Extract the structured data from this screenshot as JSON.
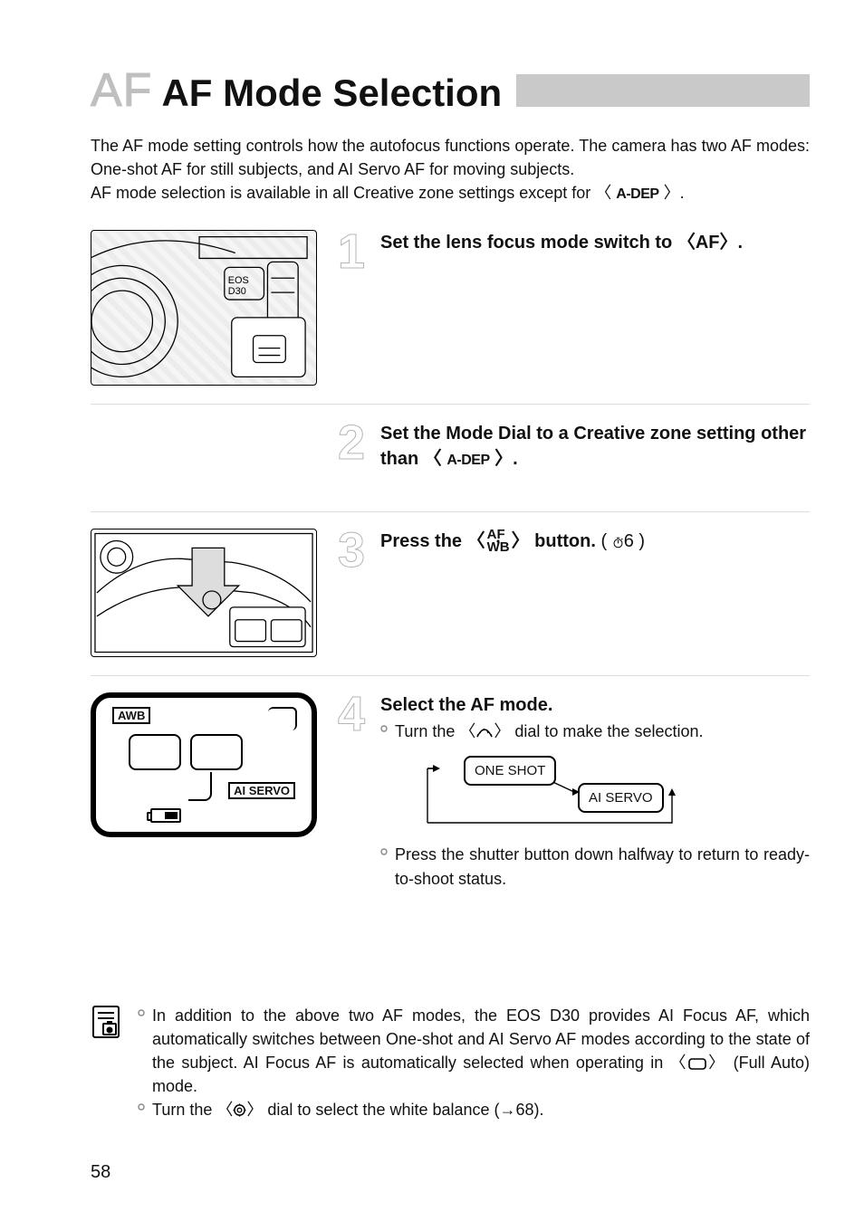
{
  "title": {
    "prefix": "AF",
    "main": "AF Mode Selection"
  },
  "intro": {
    "line1": "The AF mode setting controls how the autofocus functions operate. The camera has two AF modes: One-shot AF for still subjects, and AI Servo AF for moving subjects.",
    "line2_pre": "AF mode selection is available in all Creative zone settings except for 〈 ",
    "adep": "A-DEP",
    "line2_post": " 〉."
  },
  "steps": {
    "s1": {
      "num": "1",
      "heading_pre": "Set the lens focus mode switch to 〈",
      "heading_bold": "AF",
      "heading_post": "〉."
    },
    "s2": {
      "num": "2",
      "heading_pre": "Set the Mode Dial to a Creative zone setting other than 〈 ",
      "adep": "A-DEP",
      "heading_post": " 〉."
    },
    "s3": {
      "num": "3",
      "heading_pre": "Press the 〈",
      "af_top": "AF",
      "af_bot": "WB",
      "heading_mid": "〉 button.",
      "timer_annot": "6"
    },
    "s4": {
      "num": "4",
      "heading": "Select the AF mode.",
      "bullet1_pre": "Turn the 〈",
      "bullet1_post": "〉 dial to make the selection.",
      "oneshot": "ONE SHOT",
      "aiservo": "AI SERVO",
      "bullet2": "Press the shutter button down halfway to return to ready-to-shoot status."
    }
  },
  "lcd": {
    "awb": "AWB",
    "aiservo": "AI SERVO"
  },
  "note": {
    "b1_pre": "In addition to the above two AF modes, the EOS D30 provides AI Focus AF, which automatically switches between One-shot and AI Servo AF modes according to the state of the subject. AI Focus AF is automatically selected when operating in 〈",
    "b1_post": "〉 (Full Auto) mode.",
    "b2_pre": "Turn the 〈",
    "b2_post": "〉 dial to select the white balance (→68)."
  },
  "pageNumber": "58"
}
